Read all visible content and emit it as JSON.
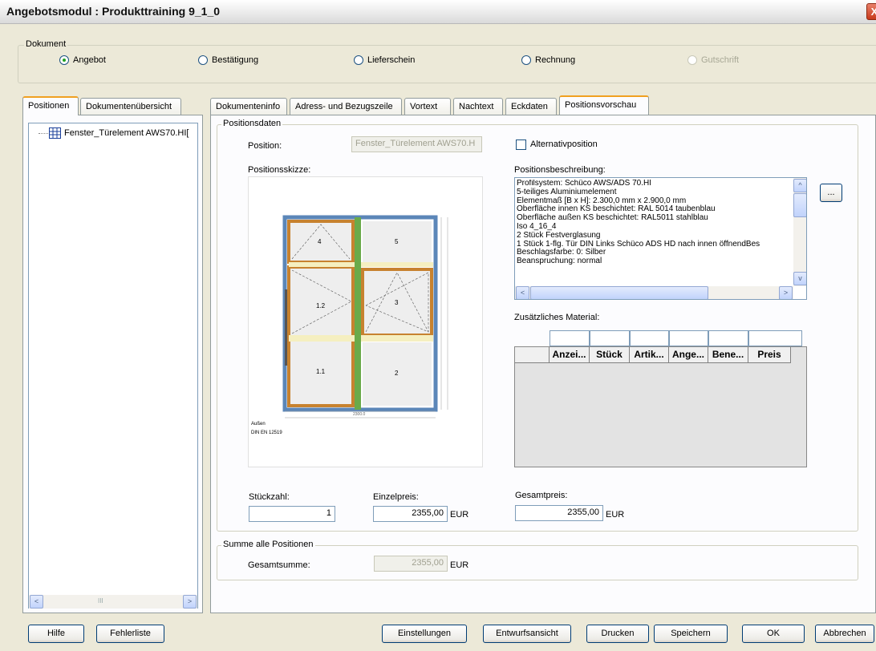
{
  "window": {
    "title": "Angebotsmodul : Produkttraining 9_1_0",
    "close": "X"
  },
  "document_group": {
    "legend": "Dokument",
    "options": [
      {
        "label": "Angebot",
        "selected": true,
        "disabled": false
      },
      {
        "label": "Bestätigung",
        "selected": false,
        "disabled": false
      },
      {
        "label": "Lieferschein",
        "selected": false,
        "disabled": false
      },
      {
        "label": "Rechnung",
        "selected": false,
        "disabled": false
      },
      {
        "label": "Gutschrift",
        "selected": false,
        "disabled": true
      }
    ]
  },
  "left_tabs": [
    "Positionen",
    "Dokumentenübersicht"
  ],
  "tree": {
    "item": "Fenster_Türelement AWS70.HI["
  },
  "tabs": [
    "Dokumenteninfo",
    "Adress- und Bezugszeile",
    "Vortext",
    "Nachtext",
    "Eckdaten",
    "Positionsvorschau"
  ],
  "position_data": {
    "legend": "Positionsdaten",
    "position_label": "Position:",
    "position_value": "Fenster_Türelement AWS70.H",
    "alt_label": "Alternativposition",
    "sketch_label": "Positionsskizze:",
    "desc_label": "Positionsbeschreibung:",
    "description_lines": [
      "Profilsystem: Schüco AWS/ADS 70.HI",
      "5-teiliges Aluminiumelement",
      "Elementmaß [B x H]: 2.300,0 mm x 2.900,0 mm",
      "Oberfläche innen KS beschichtet: RAL 5014 taubenblau",
      "Oberfläche außen KS beschichtet: RAL5011 stahlblau",
      "Iso 4_16_4",
      "2 Stück Festverglasung",
      "1 Stück 1-flg. Tür DIN Links Schüco ADS HD    nach innen öffnendBes",
      "Beschlagsfarbe: 0: Silber",
      "Beanspruchung: normal"
    ],
    "more_button": "...",
    "extra_material_label": "Zusätzliches Material:",
    "material_columns": [
      "",
      "Anzei...",
      "Stück",
      "Artik...",
      "Ange...",
      "Bene...",
      "Preis"
    ],
    "sketch": {
      "panels": [
        "4",
        "5",
        "1.2",
        "3",
        "1.1",
        "2"
      ],
      "caption_1": "Außen",
      "caption_2": "DIN EN 12519",
      "dim_bottom": "2300.0"
    },
    "qty_label": "Stückzahl:",
    "qty_value": "1",
    "unit_price_label": "Einzelpreis:",
    "unit_price_value": "2355,00",
    "total_price_label": "Gesamtpreis:",
    "total_price_value": "2355,00",
    "currency": "EUR"
  },
  "sum_group": {
    "legend": "Summe alle Positionen",
    "label": "Gesamtsumme:",
    "value": "2355,00",
    "currency": "EUR"
  },
  "footer_buttons": [
    "Hilfe",
    "Fehlerliste",
    "Einstellungen",
    "Entwurfsansicht",
    "Drucken",
    "Speichern",
    "OK",
    "Abbrechen"
  ],
  "scroll": {
    "left": "<",
    "right": ">",
    "up": "^",
    "down": "v",
    "grip": "III"
  }
}
